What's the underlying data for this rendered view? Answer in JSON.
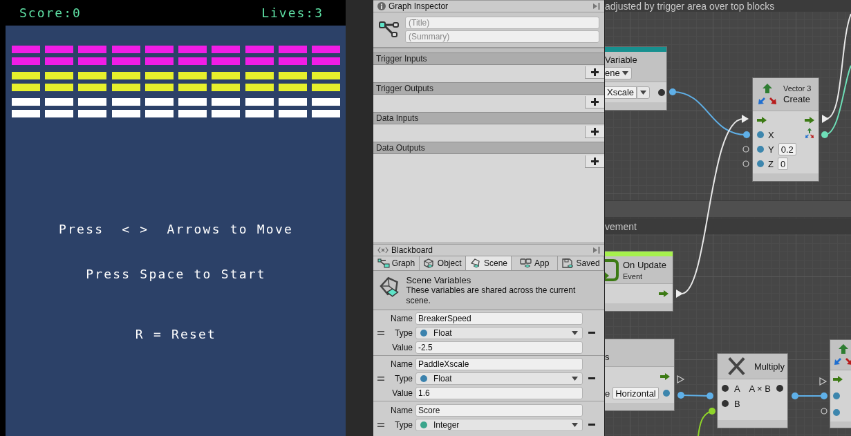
{
  "game": {
    "score": "Score:0",
    "lives": "Lives:3",
    "brick_rows": [
      {
        "color": "#f01de6"
      },
      {
        "color": "#f01de6"
      },
      {
        "color": "#e6f02c"
      },
      {
        "color": "#e6f02c"
      },
      {
        "color": "#ffffff"
      },
      {
        "color": "#ffffff"
      }
    ],
    "messages": [
      "Press  < >  Arrows to Move",
      "Press Space to Start",
      "R = Reset"
    ]
  },
  "graph_inspector": {
    "title": "Graph Inspector",
    "title_placeholder": "(Title)",
    "summary_placeholder": "(Summary)",
    "sections": [
      {
        "label": "Trigger Inputs"
      },
      {
        "label": "Trigger Outputs"
      },
      {
        "label": "Data Inputs"
      },
      {
        "label": "Data Outputs"
      }
    ]
  },
  "blackboard": {
    "title": "Blackboard",
    "tabs": [
      {
        "label": "Graph",
        "selected": false
      },
      {
        "label": "Object",
        "selected": false
      },
      {
        "label": "Scene",
        "selected": true
      },
      {
        "label": "App",
        "selected": false
      },
      {
        "label": "Saved",
        "selected": false
      }
    ],
    "heading": "Scene Variables",
    "description": "These variables are shared across the current scene.",
    "variables": [
      {
        "name_label": "Name",
        "name": "BreakerSpeed",
        "type_label": "Type",
        "type": "Float",
        "color": "#3b82ad",
        "value_label": "Value",
        "value": "-2.5"
      },
      {
        "name_label": "Name",
        "name": "PaddleXscale",
        "type_label": "Type",
        "type": "Float",
        "color": "#3b82ad",
        "value_label": "Value",
        "value": "1.6"
      },
      {
        "name_label": "Name",
        "name": "Score",
        "type_label": "Type",
        "type": "Integer",
        "color": "#3aa58c"
      }
    ]
  },
  "graph": {
    "groups": [
      {
        "title": "adjusted by trigger area over top blocks"
      },
      {
        "title": "vement"
      }
    ],
    "nodes": [
      {
        "kind": "variable",
        "color": "#17908f",
        "title": "Variable",
        "scope": "ene",
        "variable": "Xscale"
      },
      {
        "kind": "vector3",
        "subtitle": "Vector 3",
        "title": "Create",
        "ports": [
          {
            "label": "X"
          },
          {
            "label": "Y",
            "value": "0.2"
          },
          {
            "label": "Z",
            "value": "0"
          }
        ]
      },
      {
        "kind": "event",
        "color": "#a6f04e",
        "title": "On Update",
        "subtitle": "Event"
      },
      {
        "kind": "input",
        "title": "s",
        "label": "e",
        "value": "Horizontal"
      },
      {
        "kind": "multiply",
        "title": "Multiply",
        "inputs": [
          "A",
          "B"
        ],
        "output": "A × B"
      },
      {
        "kind": "vector_partial"
      }
    ]
  }
}
